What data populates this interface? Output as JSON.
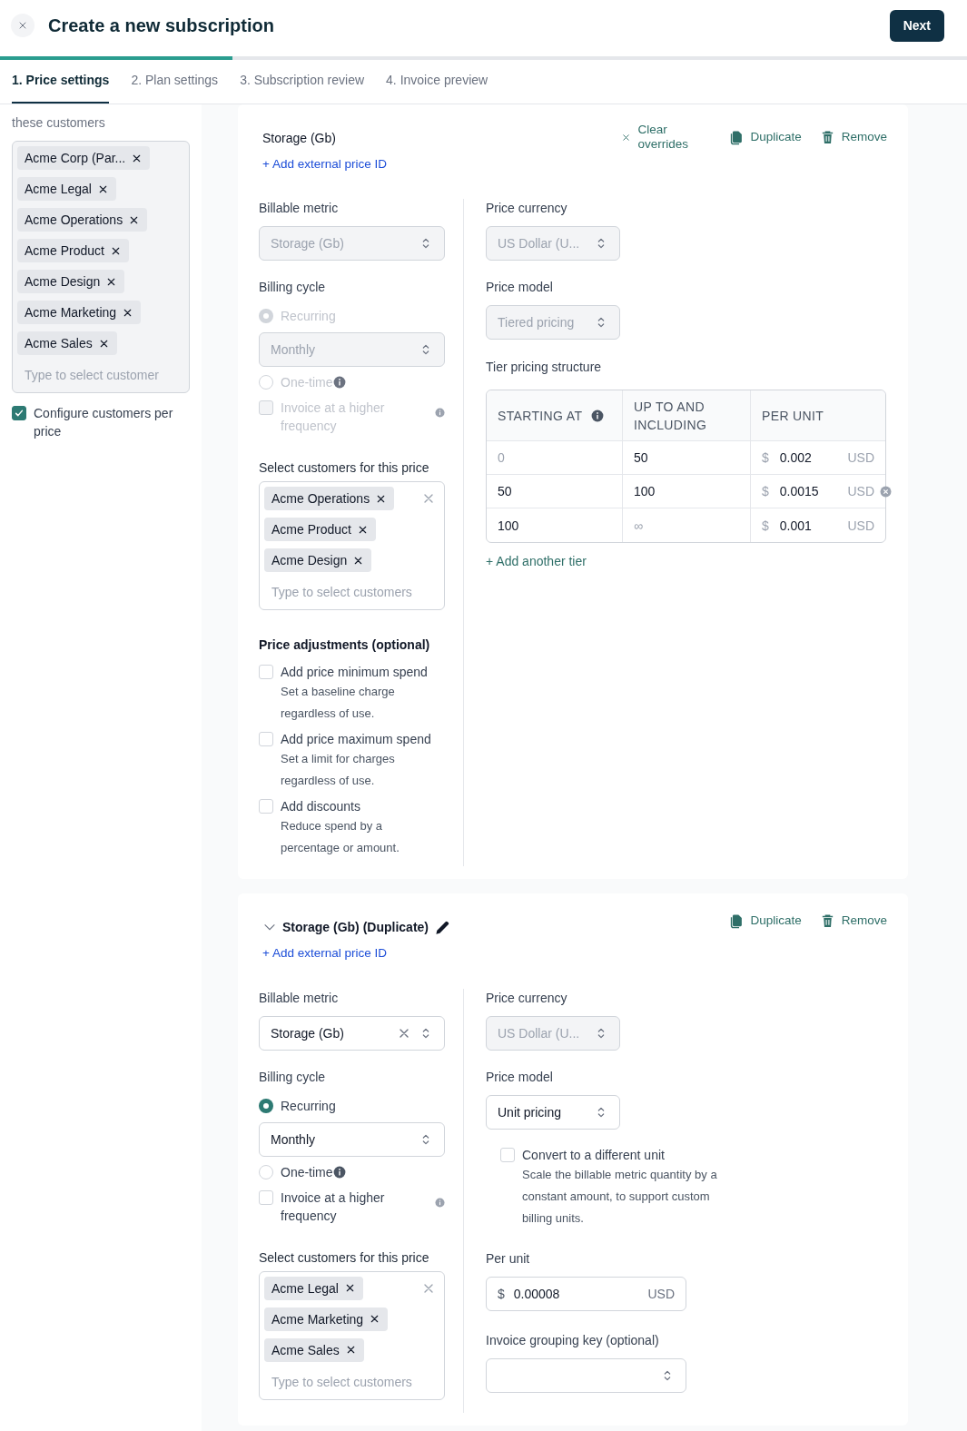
{
  "header": {
    "title": "Create a new subscription",
    "next_button": "Next"
  },
  "progress": {
    "level": 0.24
  },
  "steps": [
    {
      "label": "1. Price settings",
      "selected": true
    },
    {
      "label": "2. Plan settings",
      "selected": false
    },
    {
      "label": "3. Subscription review",
      "selected": false
    },
    {
      "label": "4. Invoice preview",
      "selected": false
    }
  ],
  "sidebar": {
    "note": "these customers",
    "customers": [
      "Acme Corp (Par...",
      "Acme Legal",
      "Acme Operations",
      "Acme Product",
      "Acme Design",
      "Acme Marketing",
      "Acme Sales"
    ],
    "placeholder": "Type to select customer",
    "configure_per_price": {
      "label": "Configure customers per price",
      "checked": true
    }
  },
  "prices": [
    {
      "name": "Storage (Gb)",
      "editable": false,
      "actions": [
        {
          "kind": "clear",
          "label": "Clear overrides"
        },
        {
          "kind": "duplicate",
          "label": "Duplicate"
        },
        {
          "kind": "remove",
          "label": "Remove"
        }
      ],
      "add_external_id": "+ Add external price ID",
      "billable_metric": {
        "label": "Billable metric",
        "value": "Storage (Gb)",
        "disabled": true,
        "clearable": false
      },
      "billing_cycle": {
        "label": "Billing cycle",
        "disabled": true,
        "options": [
          {
            "label": "Recurring",
            "selected": true
          },
          {
            "label": "One-time",
            "selected": false
          }
        ],
        "period": "Monthly"
      },
      "invoice_higher_frequency": {
        "label": "Invoice at a higher frequency",
        "checked": false
      },
      "customers": {
        "label": "Select customers for this price",
        "tags": [
          "Acme Operations",
          "Acme Product",
          "Acme Design"
        ],
        "placeholder": "Type to select customers"
      },
      "adjustments": {
        "title": "Price adjustments (optional)",
        "items": [
          {
            "label": "Add price minimum spend",
            "description": "Set a baseline charge regardless of use.",
            "checked": false
          },
          {
            "label": "Add price maximum spend",
            "description": "Set a limit for charges regardless of use.",
            "checked": false
          },
          {
            "label": "Add discounts",
            "description": "Reduce spend by a percentage or amount.",
            "checked": false
          }
        ]
      },
      "currency": {
        "label": "Price currency",
        "value": "US Dollar (U...",
        "disabled": true
      },
      "price_model": {
        "label": "Price model",
        "value": "Tiered pricing",
        "disabled": true,
        "kind": "tiered"
      },
      "tiers": {
        "title": "Tier pricing structure",
        "columns": [
          "STARTING AT",
          "UP TO AND INCLUDING",
          "PER UNIT"
        ],
        "rows": [
          {
            "start": "0",
            "start_muted": true,
            "end": "50",
            "end_muted": false,
            "symbol": "$",
            "unit_price": "0.002",
            "currency": "USD",
            "removable": false
          },
          {
            "start": "50",
            "start_muted": false,
            "end": "100",
            "end_muted": false,
            "symbol": "$",
            "unit_price": "0.0015",
            "currency": "USD",
            "removable": true
          },
          {
            "start": "100",
            "start_muted": false,
            "end": "∞",
            "end_muted": true,
            "symbol": "$",
            "unit_price": "0.001",
            "currency": "USD",
            "removable": false
          }
        ],
        "add_tier": "+ Add another tier"
      }
    },
    {
      "name": "Storage (Gb) (Duplicate)",
      "editable": true,
      "expanded": true,
      "actions": [
        {
          "kind": "duplicate",
          "label": "Duplicate"
        },
        {
          "kind": "remove",
          "label": "Remove"
        }
      ],
      "add_external_id": "+ Add external price ID",
      "billable_metric": {
        "label": "Billable metric",
        "value": "Storage (Gb)",
        "disabled": false,
        "clearable": true
      },
      "billing_cycle": {
        "label": "Billing cycle",
        "disabled": false,
        "options": [
          {
            "label": "Recurring",
            "selected": true
          },
          {
            "label": "One-time",
            "selected": false
          }
        ],
        "period": "Monthly"
      },
      "invoice_higher_frequency": {
        "label": "Invoice at a higher frequency",
        "checked": false
      },
      "customers": {
        "label": "Select customers for this price",
        "tags": [
          "Acme Legal",
          "Acme Marketing",
          "Acme Sales"
        ],
        "placeholder": "Type to select customers"
      },
      "currency": {
        "label": "Price currency",
        "value": "US Dollar (U...",
        "disabled": true
      },
      "price_model": {
        "label": "Price model",
        "value": "Unit pricing",
        "disabled": false,
        "kind": "unit"
      },
      "unit": {
        "convert": {
          "label": "Convert to a different unit",
          "description": "Scale the billable metric quantity by a constant amount, to support custom billing units.",
          "checked": false
        },
        "per_unit": {
          "label": "Per unit",
          "symbol": "$",
          "value": "0.00008",
          "currency": "USD"
        },
        "grouping_key": {
          "label": "Invoice grouping key (optional)"
        }
      }
    }
  ]
}
